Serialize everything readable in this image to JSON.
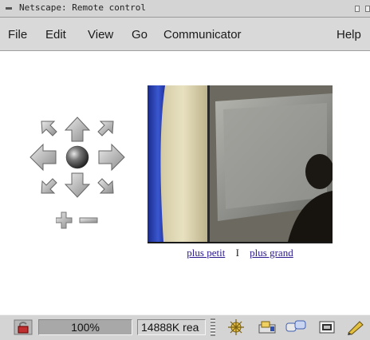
{
  "window": {
    "title": "Netscape: Remote control"
  },
  "menu": {
    "file": "File",
    "edit": "Edit",
    "view": "View",
    "go": "Go",
    "communicator": "Communicator",
    "help": "Help"
  },
  "page": {
    "links": {
      "smaller": "plus petit",
      "separator": "I",
      "bigger": "plus grand"
    }
  },
  "status": {
    "zoom": "100%",
    "memory": "14888K rea"
  },
  "icons": {
    "lock": "padlock-icon",
    "components": [
      "navigator-icon",
      "mailbox-icon",
      "discussion-icon",
      "composer-icon",
      "pen-icon"
    ]
  },
  "colors": {
    "link": "#2a1a8c",
    "chrome": "#d4d4d4",
    "arrow": "#a9a9a9"
  }
}
